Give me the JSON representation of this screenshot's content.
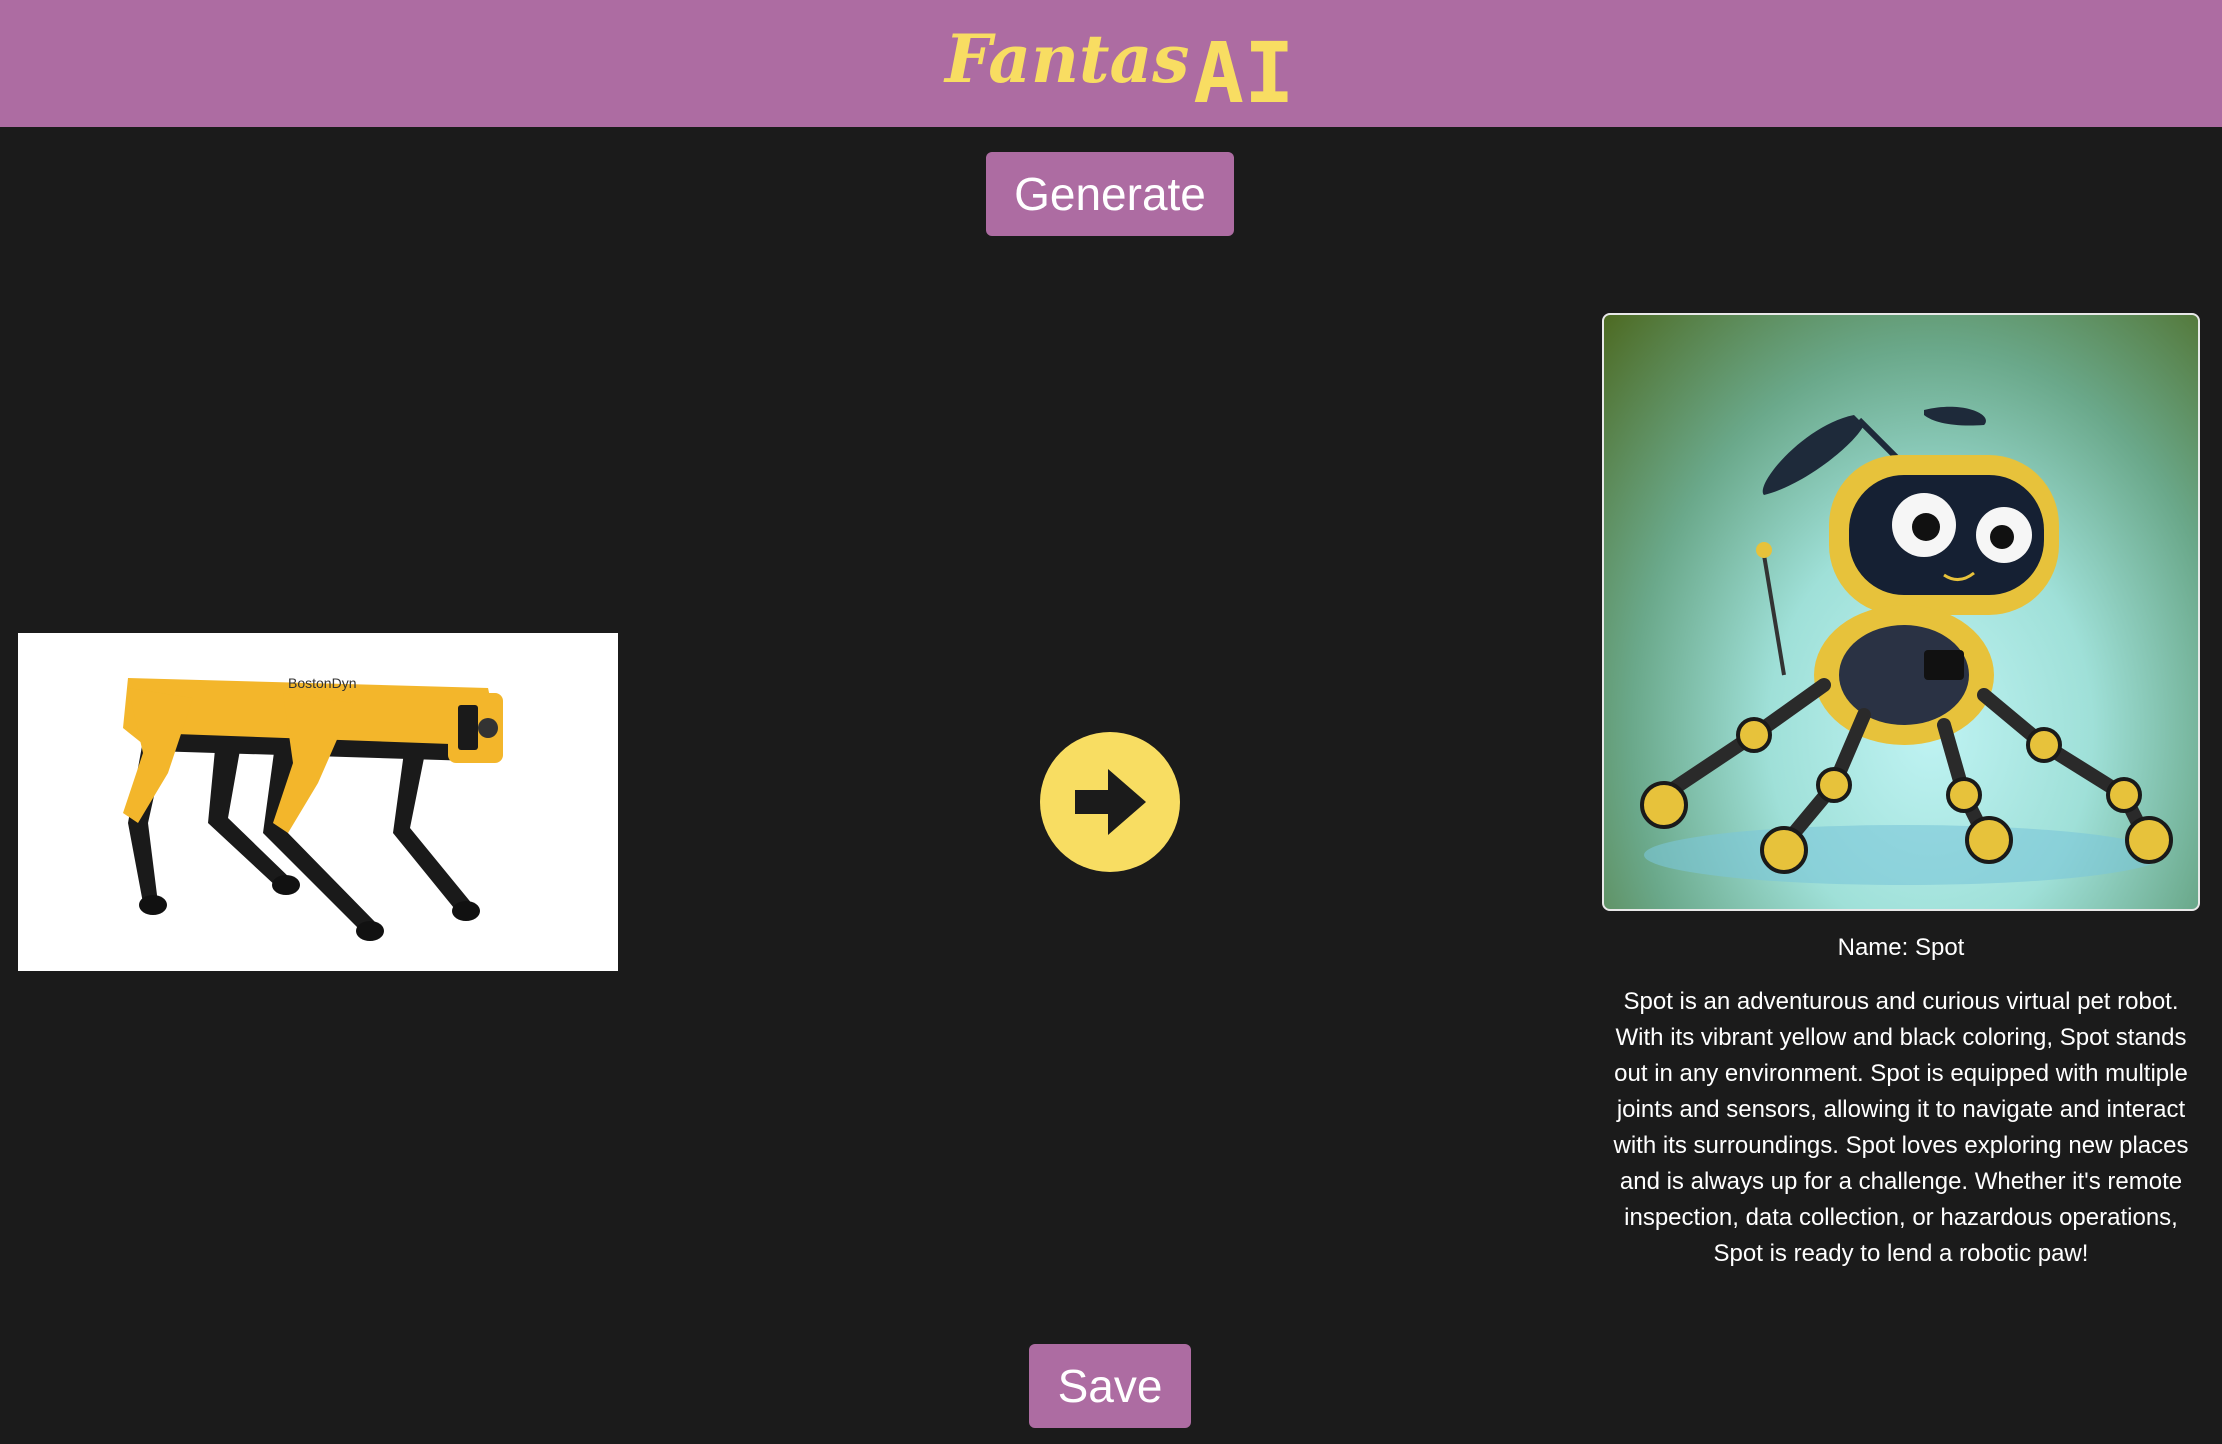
{
  "header": {
    "logo_script": "Fantas",
    "logo_ai": "AI",
    "background_color": "#ad6ca2",
    "logo_color": "#f8dd62"
  },
  "actions": {
    "generate_label": "Generate",
    "save_label": "Save"
  },
  "input": {
    "image_icon": "quadruped-robot-dog-photo",
    "brand_text": "BostonDyn"
  },
  "transition": {
    "icon": "arrow-right-circle-icon",
    "color": "#f8dd62"
  },
  "output": {
    "image_icon": "cartoon-robot-pet-illustration",
    "name_line": "Name: Spot",
    "description": "Spot is an adventurous and curious virtual pet robot. With its vibrant yellow and black coloring, Spot stands out in any environment. Spot is equipped with multiple joints and sensors, allowing it to navigate and interact with its surroundings. Spot loves exploring new places and is always up for a challenge. Whether it's remote inspection, data collection, or hazardous operations, Spot is ready to lend a robotic paw!"
  }
}
